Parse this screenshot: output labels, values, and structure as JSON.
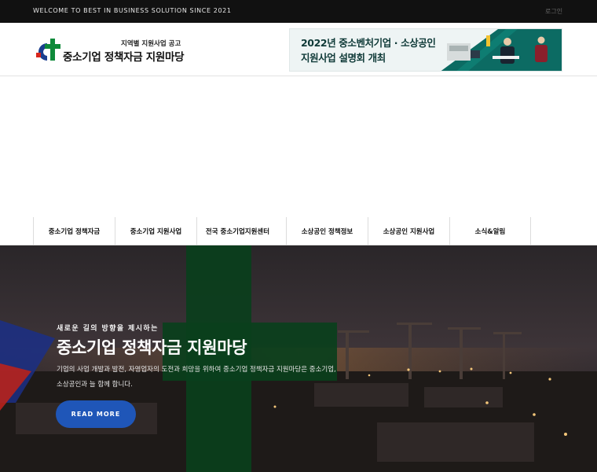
{
  "topbar": {
    "welcome": "WELCOME TO BEST IN BUSINESS SOLUTION SINCE 2021",
    "login": "로그인"
  },
  "header": {
    "logo_sub": "지역별 지원사업 공고",
    "logo_main": "중소기업 정책자금 지원마당",
    "logo_icon": "c-plus-logo-icon",
    "banner_line1": "2022년 중소벤처기업 · 소상공인",
    "banner_line2": "지원사업 설명회 개최",
    "banner_colors": {
      "text": "#0f3a38",
      "accent": "#0c6b63"
    }
  },
  "nav": {
    "items": [
      {
        "label": "중소기업 정책자금"
      },
      {
        "label": "중소기업 지원사업"
      },
      {
        "label": "전국 중소기업지원센터"
      },
      {
        "label": "소상공인 정책정보"
      },
      {
        "label": "소상공인 지원사업"
      },
      {
        "label": "소식&알림"
      }
    ]
  },
  "hero": {
    "kicker": "새로운 길의 방향을 제시하는",
    "title": "중소기업 정책자금 지원마당",
    "description": "기업의 사업 개발과 발전, 자영업자의 도전과 희망을 위하여 중소기업 정책자금 지원마당은 중소기업, 소상공인과 늘 함께 합니다.",
    "cta_label": "READ MORE",
    "colors": {
      "cta": "#1f56b8",
      "cross": "#0a3f1c"
    }
  }
}
